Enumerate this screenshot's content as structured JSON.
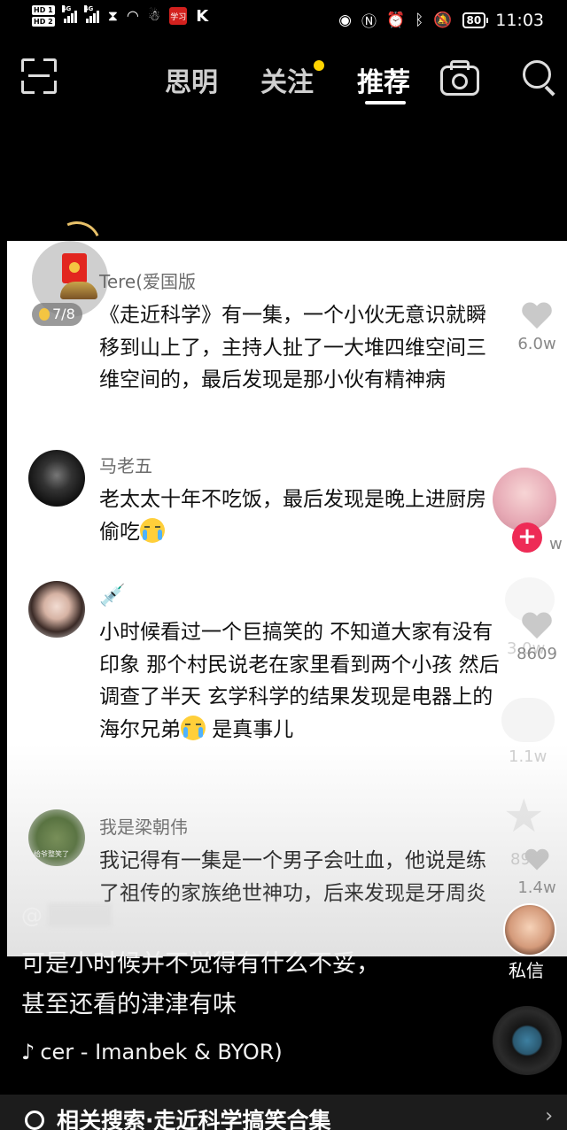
{
  "status_bar": {
    "sim1": "HD 1",
    "sim2": "HD 2",
    "net1": "4G",
    "net2": "4G",
    "red_app": "学习",
    "k_app": "K",
    "battery": "80",
    "time": "11:03"
  },
  "top_nav": {
    "tabs": [
      "思明",
      "关注",
      "推荐"
    ],
    "active_tab": "推荐"
  },
  "comments": [
    {
      "user": "Tere(爱国版",
      "text": "《走近科学》有一集，一个小伙无意识就瞬移到山上了，主持人扯了一大堆四维空间三维空间的，最后发现是那小伙有精神病",
      "likes": "6.0w",
      "badge": "7/8"
    },
    {
      "user": "马老五",
      "text": "老太太十年不吃饭，最后发现是晚上进厨房偷吃",
      "likes": "w"
    },
    {
      "user": "",
      "prefix_icon": "💉",
      "text": "小时候看过一个巨搞笑的 不知道大家有没有印象 那个村民说老在家里看到两个小孩 然后调查了半天 玄学科学的结果发现是电器上的海尔兄弟",
      "text_after": " 是真事儿",
      "likes": "8609",
      "ghost_likes": "3.0w"
    },
    {
      "user": "我是梁朝伟",
      "text": "我记得有一集是一个男子会吐血，他说是练了祖传的家族绝世神功，后来发现是牙周炎",
      "likes": "1.4w",
      "ghost_likes": "892",
      "avatar_caption": "给爷整笑了"
    }
  ],
  "overlay": {
    "comment_count": "1.1w",
    "dm_label": "私信"
  },
  "video": {
    "at_user": "@",
    "caption": "可是小时候并不觉得有什么不妥，甚至还看的津津有味",
    "music": "cer - Imanbek & BYOR)"
  },
  "related_search": {
    "text": "相关搜索·走近科学搞笑合集"
  }
}
